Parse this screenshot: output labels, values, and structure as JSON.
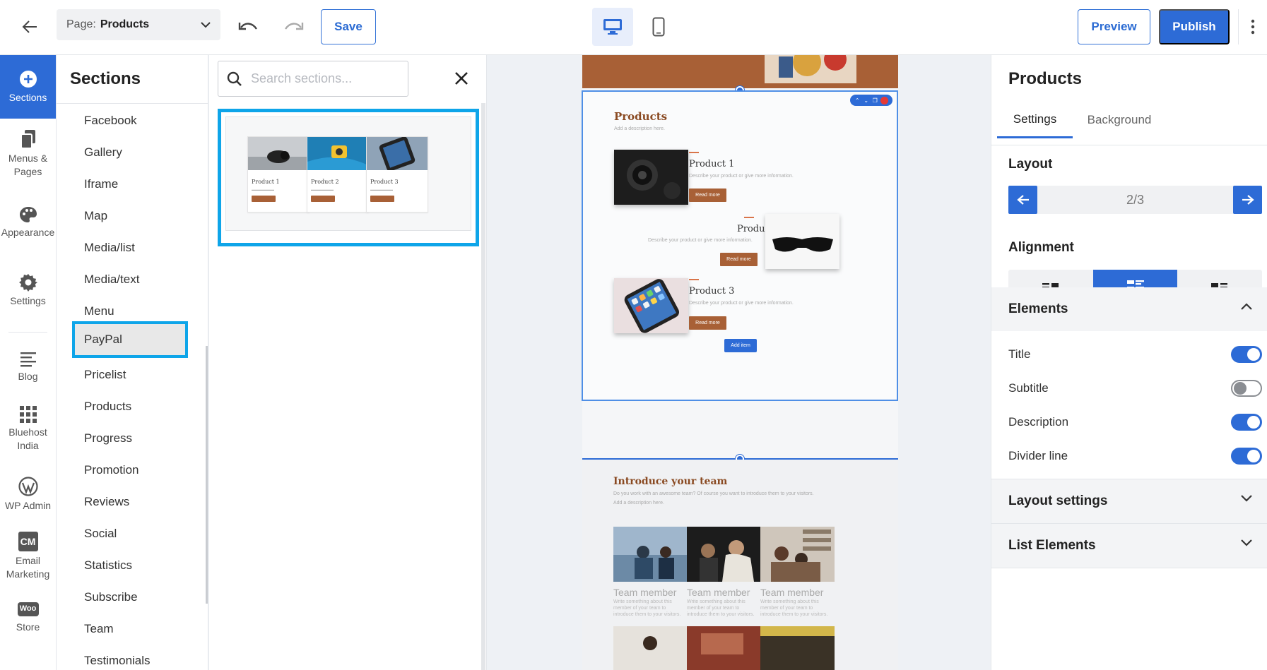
{
  "topbar": {
    "page_label": "Page:",
    "page_value": "Products",
    "save_label": "Save",
    "preview_label": "Preview",
    "publish_label": "Publish"
  },
  "rail": {
    "items": [
      {
        "label": "Sections",
        "icon": "plus-circle-icon"
      },
      {
        "label": "Menus & Pages",
        "icon": "pages-icon"
      },
      {
        "label": "Appearance",
        "icon": "palette-icon"
      },
      {
        "label": "Settings",
        "icon": "gear-icon"
      },
      {
        "label": "Blog",
        "icon": "blog-lines-icon"
      },
      {
        "label": "Bluehost India",
        "icon": "grid-icon"
      },
      {
        "label": "WP Admin",
        "icon": "wordpress-icon"
      },
      {
        "label": "Email Marketing",
        "icon": "cm-icon"
      },
      {
        "label": "Store",
        "icon": "woo-icon"
      }
    ],
    "cm_text": "CM",
    "woo_text": "Woo"
  },
  "sections": {
    "title": "Sections",
    "items": [
      "Facebook",
      "Gallery",
      "Iframe",
      "Map",
      "Media/list",
      "Media/text",
      "Menu",
      "PayPal",
      "Pricelist",
      "Products",
      "Progress",
      "Promotion",
      "Reviews",
      "Social",
      "Statistics",
      "Subscribe",
      "Team",
      "Testimonials"
    ],
    "highlighted": "PayPal"
  },
  "search": {
    "placeholder": "Search sections..."
  },
  "preview_thumb": {
    "cards": [
      {
        "title": "Product 1"
      },
      {
        "title": "Product 2"
      },
      {
        "title": "Product 3"
      }
    ]
  },
  "canvas": {
    "products_heading": "Products",
    "products_sub": "Add a description here.",
    "products": [
      {
        "title": "Product 1",
        "desc": "Describe your product or give more information.",
        "button": "Read more"
      },
      {
        "title": "Product 2",
        "desc": "Describe your product or give more information.",
        "button": "Read more"
      },
      {
        "title": "Product 3",
        "desc": "Describe your product or give more information.",
        "button": "Read more"
      }
    ],
    "add_item": "Add item",
    "team_heading": "Introduce your team",
    "team_sub1": "Do you work with an awesome team? Of course you want to introduce them to your visitors.",
    "team_sub2": "Add a description here.",
    "team_members": [
      {
        "name": "Team member",
        "desc": "Write something about this member of your team to introduce them to your visitors."
      },
      {
        "name": "Team member",
        "desc": "Write something about this member of your team to introduce them to your visitors."
      },
      {
        "name": "Team member",
        "desc": "Write something about this member of your team to introduce them to your visitors."
      }
    ]
  },
  "right_panel": {
    "title": "Products",
    "tabs": [
      "Settings",
      "Background"
    ],
    "layout_label": "Layout",
    "layout_value": "2/3",
    "alignment_label": "Alignment",
    "elements_label": "Elements",
    "toggles": [
      {
        "label": "Title",
        "on": true
      },
      {
        "label": "Subtitle",
        "on": false
      },
      {
        "label": "Description",
        "on": true
      },
      {
        "label": "Divider line",
        "on": true
      }
    ],
    "layout_settings_label": "Layout settings",
    "list_elements_label": "List Elements"
  },
  "colors": {
    "accent": "#2d6bd6",
    "highlight": "#0ea5e9",
    "brand_brown": "#a86036"
  }
}
